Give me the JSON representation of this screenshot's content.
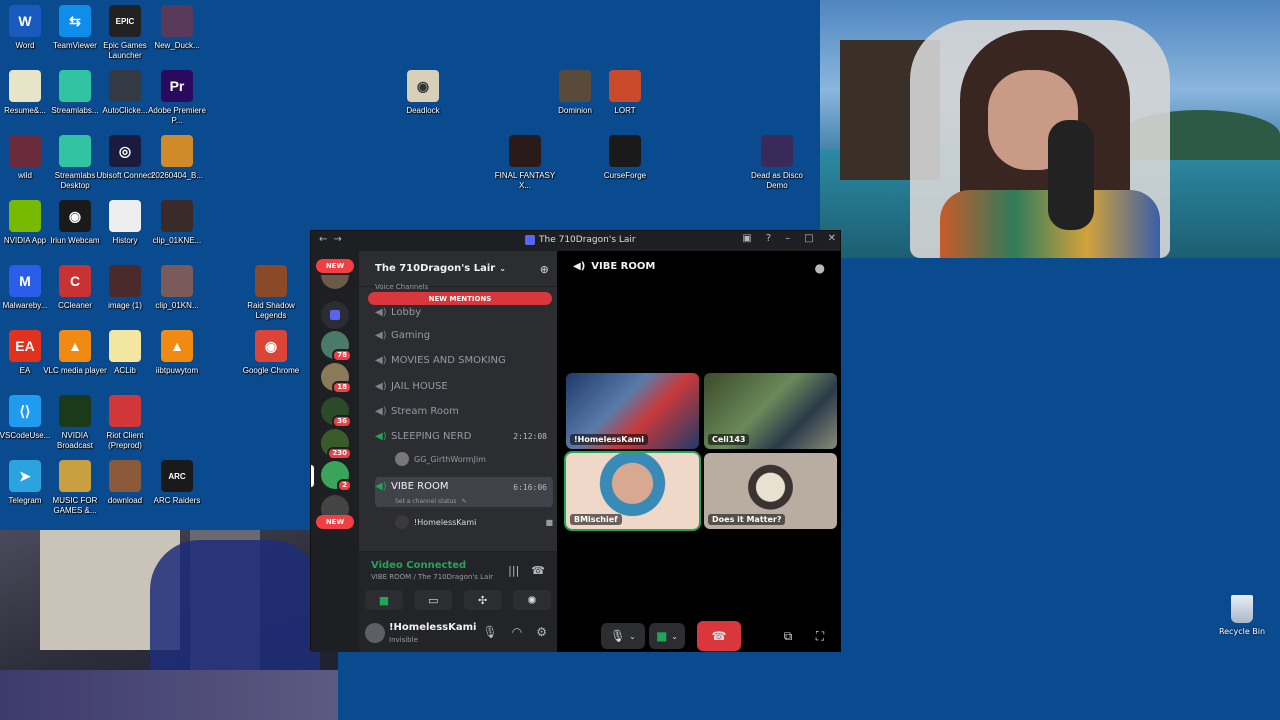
{
  "desktop_icons": [
    {
      "label": "Word",
      "glyph": "W",
      "color": "#185abd"
    },
    {
      "label": "TeamViewer",
      "glyph": "⇆",
      "color": "#0e8ee9"
    },
    {
      "label": "Epic Games Launcher",
      "glyph": "EPIC",
      "color": "#222222"
    },
    {
      "label": "New_Duck...",
      "glyph": "",
      "color": "#5a3a5a"
    },
    {
      "label": "Resume&...",
      "glyph": "",
      "color": "#e8e4c8"
    },
    {
      "label": "Streamlabs...",
      "glyph": "",
      "color": "#31c3a2"
    },
    {
      "label": "AutoClicke...",
      "glyph": "",
      "color": "#333a44"
    },
    {
      "label": "Adobe Premiere P...",
      "glyph": "Pr",
      "color": "#2a0a5c"
    },
    {
      "label": "wild",
      "glyph": "",
      "color": "#6a2a3a"
    },
    {
      "label": "Streamlabs Desktop",
      "glyph": "",
      "color": "#31c3a2"
    },
    {
      "label": "Ubisoft Connect",
      "glyph": "◎",
      "color": "#1b1b40"
    },
    {
      "label": "20260404_B...",
      "glyph": "",
      "color": "#d08a2a"
    },
    {
      "label": "NVIDIA App",
      "glyph": "",
      "color": "#76b900"
    },
    {
      "label": "Iriun Webcam",
      "glyph": "◉",
      "color": "#1a1a1a"
    },
    {
      "label": "History",
      "glyph": "",
      "color": "#eeeeee"
    },
    {
      "label": "clip_01KNE...",
      "glyph": "",
      "color": "#3a2a2a"
    },
    {
      "label": "Malwareby...",
      "glyph": "M",
      "color": "#2a5ee8"
    },
    {
      "label": "CCleaner",
      "glyph": "C",
      "color": "#c83232"
    },
    {
      "label": "image (1)",
      "glyph": "",
      "color": "#4a2a2a"
    },
    {
      "label": "clip_01KN...",
      "glyph": "",
      "color": "#7a5a5a"
    },
    {
      "label": "Raid Shadow Legends",
      "glyph": "",
      "color": "#8a4a2a"
    },
    {
      "label": "EA",
      "glyph": "EA",
      "color": "#e0321c"
    },
    {
      "label": "VLC media player",
      "glyph": "▲",
      "color": "#f08a12"
    },
    {
      "label": "ACLib",
      "glyph": "",
      "color": "#f2e6a0"
    },
    {
      "label": "iibtpuwytom",
      "glyph": "▲",
      "color": "#f08a12"
    },
    {
      "label": "Google Chrome",
      "glyph": "◉",
      "color": "#db4437"
    },
    {
      "label": "VSCodeUse...",
      "glyph": "⟨⟩",
      "color": "#1f9cf0"
    },
    {
      "label": "NVIDIA Broadcast",
      "glyph": "",
      "color": "#1a3a1a"
    },
    {
      "label": "Riot Client (Preprod)",
      "glyph": "",
      "color": "#d13639"
    },
    {
      "label": "Telegram",
      "glyph": "➤",
      "color": "#2aa3df"
    },
    {
      "label": "MUSIC FOR GAMES &...",
      "glyph": "",
      "color": "#c8a040"
    },
    {
      "label": "download",
      "glyph": "",
      "color": "#8a5a3a"
    },
    {
      "label": "ARC Raiders",
      "glyph": "ARC",
      "color": "#1a1a1a"
    },
    {
      "label": "Deadlock",
      "glyph": "◉",
      "color": "#d8cfb8"
    },
    {
      "label": "Dominion",
      "glyph": "",
      "color": "#5a4a3a"
    },
    {
      "label": "LORT",
      "glyph": "",
      "color": "#c84a2a"
    },
    {
      "label": "FINAL FANTASY X...",
      "glyph": "",
      "color": "#2a1a1a"
    },
    {
      "label": "CurseForge",
      "glyph": "",
      "color": "#1a1a1a"
    },
    {
      "label": "Dead as Disco Demo",
      "glyph": "",
      "color": "#3a2a5a"
    }
  ],
  "recycle_bin": {
    "label": "Recycle Bin"
  },
  "discord": {
    "window_title": "The 710Dragon's Lair",
    "server_name": "The 710Dragon's Lair",
    "new_pill": "NEW",
    "new_mentions": "NEW MENTIONS",
    "voice_category": "Voice Channels",
    "server_badges": [
      "78",
      "18",
      "36",
      "230",
      "2"
    ],
    "channels": [
      {
        "name": "Lobby",
        "time": "",
        "connected": false
      },
      {
        "name": "Gaming",
        "time": "",
        "connected": false
      },
      {
        "name": "MOVIES AND SMOKING",
        "time": "",
        "connected": false
      },
      {
        "name": "JAIL HOUSE",
        "time": "",
        "connected": false
      },
      {
        "name": "Stream Room",
        "time": "",
        "connected": false
      },
      {
        "name": "SLEEPING NERD",
        "time": "2:12:08",
        "connected": true
      },
      {
        "name": "VIBE ROOM",
        "time": "6:16:06",
        "connected": true
      }
    ],
    "sleeping_member": "GG_GirthWormJim",
    "channel_status_placeholder": "Set a channel status",
    "vibe_member": "!HomelessKami",
    "voice_panel": {
      "status": "Video Connected",
      "location": "VIBE ROOM / The 710Dragon's Lair"
    },
    "user": {
      "name": "!HomelessKami",
      "status": "Invisible"
    },
    "stage": {
      "title": "VIBE ROOM",
      "tiles": [
        {
          "name": "!HomelessKami",
          "bg": "#2a4a7a",
          "speaking": false
        },
        {
          "name": "Celi143",
          "bg": "#4a5a3a",
          "speaking": false
        },
        {
          "name": "BMischief",
          "bg": "#e8c8b8",
          "speaking": true
        },
        {
          "name": "Does it Matter?",
          "bg": "#b0a89a",
          "speaking": false
        }
      ]
    },
    "colors": {
      "accent_green": "#23a559",
      "danger_red": "#da373c",
      "blurple": "#5865f2"
    }
  }
}
